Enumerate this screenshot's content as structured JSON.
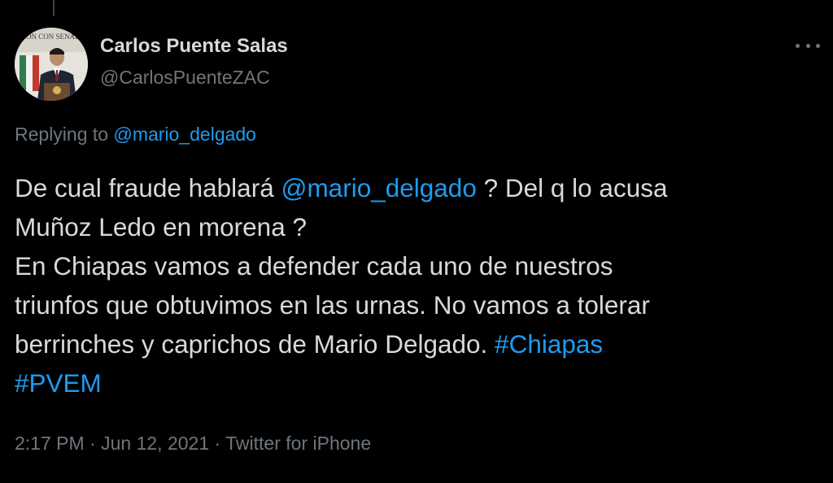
{
  "author": {
    "display_name": "Carlos Puente Salas",
    "handle": "@CarlosPuenteZAC",
    "avatar_sign_text": "REUNIÓN CON SENADORES"
  },
  "reply": {
    "prefix": "Replying to ",
    "mention": "@mario_delgado"
  },
  "tweet": {
    "line1_before": "De cual fraude hablará ",
    "line1_mention": "@mario_delgado",
    "line1_after": " ? Del q lo acusa",
    "line2": "Muñoz Ledo en morena ?",
    "line3": "En Chiapas vamos a defender cada uno de nuestros",
    "line4": "triunfos que obtuvimos en las urnas. No vamos a tolerar",
    "line5_before": "berrinches y caprichos de Mario Delgado. ",
    "hashtag1": "#Chiapas",
    "hashtag2": "#PVEM"
  },
  "meta": {
    "time": "2:17 PM",
    "separator1": " · ",
    "date": "Jun 12, 2021",
    "separator2": " · ",
    "source": "Twitter for iPhone"
  },
  "icons": {
    "more": "more-horizontal-icon"
  },
  "colors": {
    "background": "#000000",
    "text": "#d9d9d9",
    "secondary": "#6e767d",
    "link": "#1d9bf0"
  }
}
